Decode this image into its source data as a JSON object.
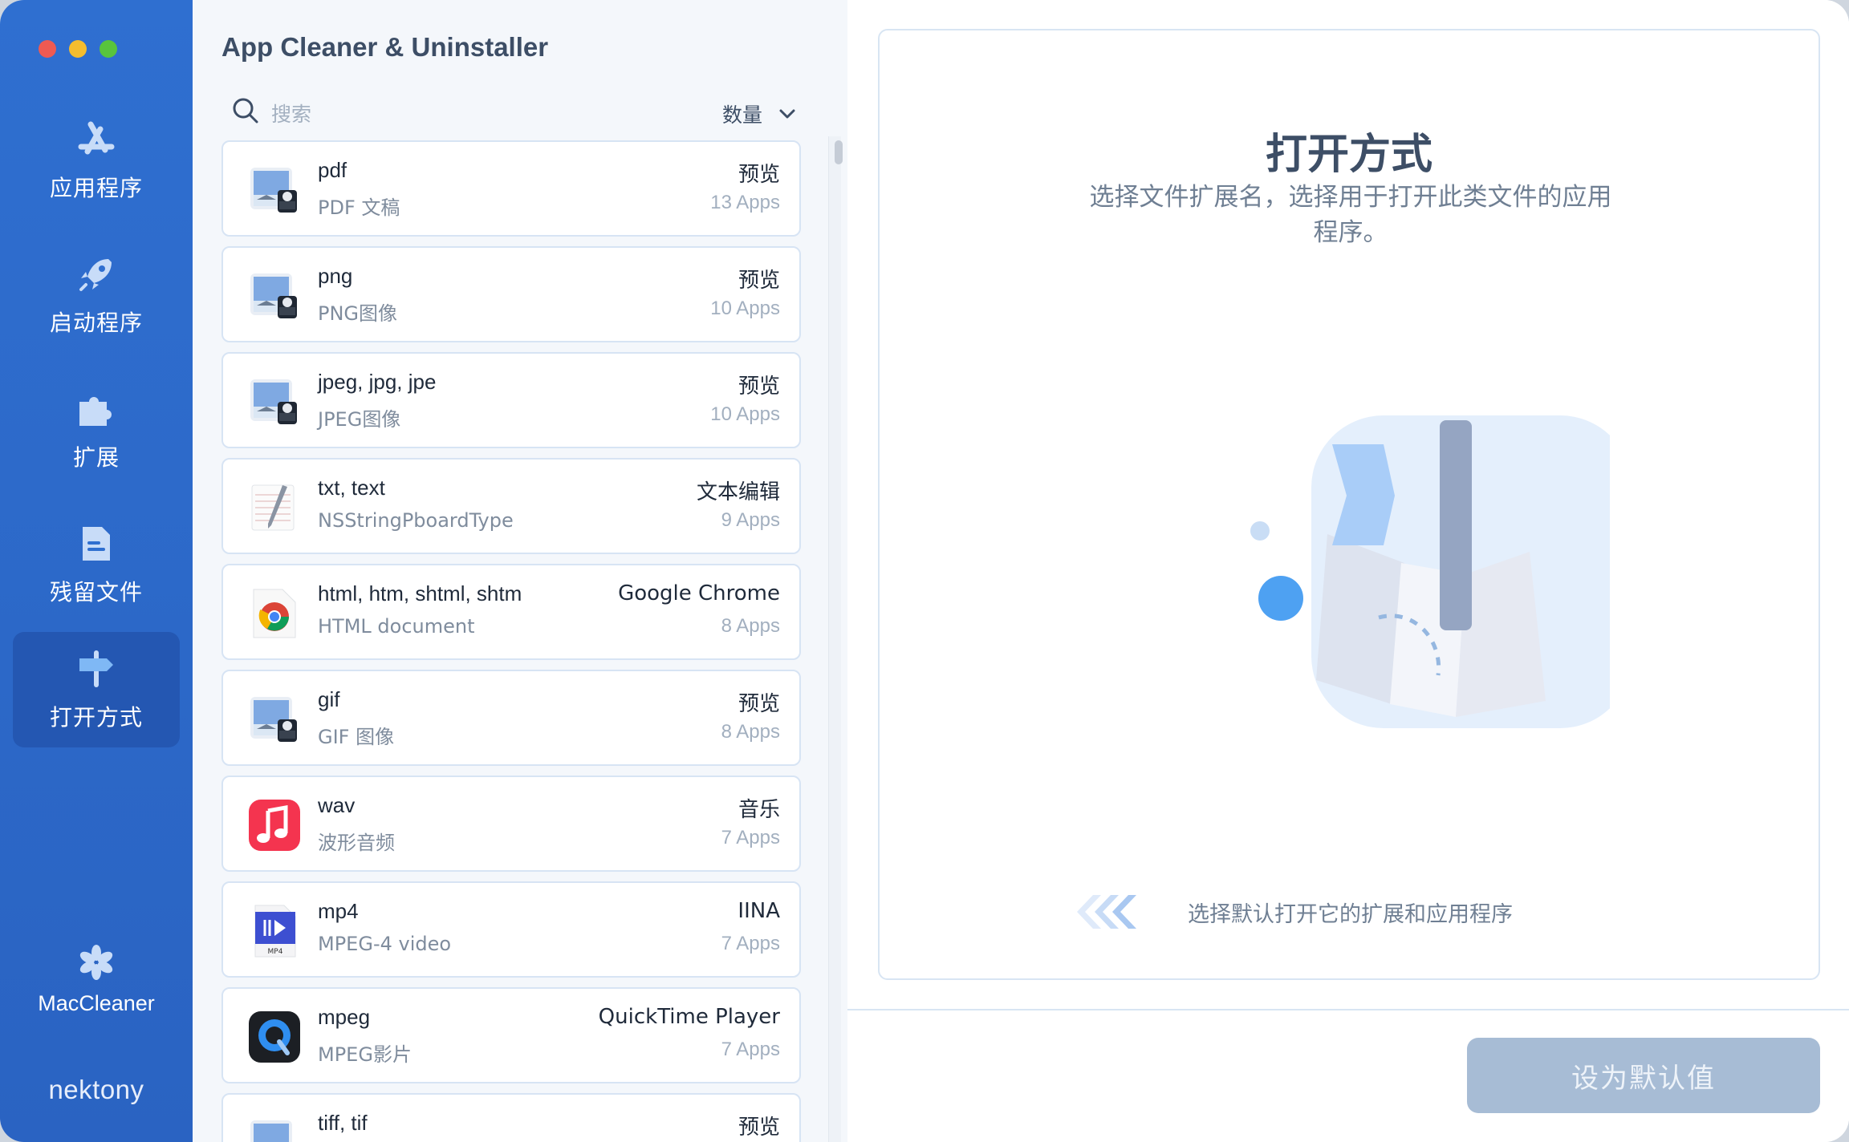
{
  "window": {
    "traffic_lights": [
      "close",
      "minimize",
      "zoom"
    ]
  },
  "sidebar": {
    "items": [
      {
        "label": "应用程序",
        "icon": "app-store-icon"
      },
      {
        "label": "启动程序",
        "icon": "rocket-icon"
      },
      {
        "label": "扩展",
        "icon": "puzzle-icon"
      },
      {
        "label": "残留文件",
        "icon": "document-icon"
      },
      {
        "label": "打开方式",
        "icon": "signpost-icon",
        "active": true
      }
    ],
    "footer_app": "MacCleaner",
    "brand": "nektony"
  },
  "list": {
    "app_title": "App Cleaner & Uninstaller",
    "search_placeholder": "搜索",
    "sort_label": "数量",
    "rows": [
      {
        "ext": "pdf",
        "desc": "PDF 文稿",
        "app": "预览",
        "count": "13 Apps",
        "icon": "preview-app-icon"
      },
      {
        "ext": "png",
        "desc": "PNG图像",
        "app": "预览",
        "count": "10 Apps",
        "icon": "preview-app-icon"
      },
      {
        "ext": "jpeg, jpg, jpe",
        "desc": "JPEG图像",
        "app": "预览",
        "count": "10 Apps",
        "icon": "preview-app-icon"
      },
      {
        "ext": "txt, text",
        "desc": "NSStringPboardType",
        "app": "文本编辑",
        "count": "9 Apps",
        "icon": "textedit-app-icon"
      },
      {
        "ext": "html, htm, shtml, shtm",
        "desc": "HTML document",
        "app": "Google Chrome",
        "count": "8 Apps",
        "icon": "chrome-app-icon"
      },
      {
        "ext": "gif",
        "desc": "GIF 图像",
        "app": "预览",
        "count": "8 Apps",
        "icon": "preview-app-icon"
      },
      {
        "ext": "wav",
        "desc": "波形音频",
        "app": "音乐",
        "count": "7 Apps",
        "icon": "music-app-icon"
      },
      {
        "ext": "mp4",
        "desc": "MPEG-4 video",
        "app": "IINA",
        "count": "7 Apps",
        "icon": "iina-mp4-icon"
      },
      {
        "ext": "mpeg",
        "desc": "MPEG影片",
        "app": "QuickTime Player",
        "count": "7 Apps",
        "icon": "quicktime-app-icon"
      },
      {
        "ext": "tiff, tif",
        "desc": "",
        "app": "预览",
        "count": "",
        "icon": "preview-app-icon"
      }
    ]
  },
  "panel": {
    "title": "打开方式",
    "subtitle": "选择文件扩展名，选择用于打开此类文件的应用程序。",
    "hint": "选择默认打开它的扩展和应用程序",
    "button_label": "设为默认值"
  },
  "colors": {
    "sidebar_bg": "#2f6fd0",
    "sidebar_active": "#2457b2",
    "button_disabled": "#a7bcd5",
    "card_border": "#d8e5f3"
  }
}
